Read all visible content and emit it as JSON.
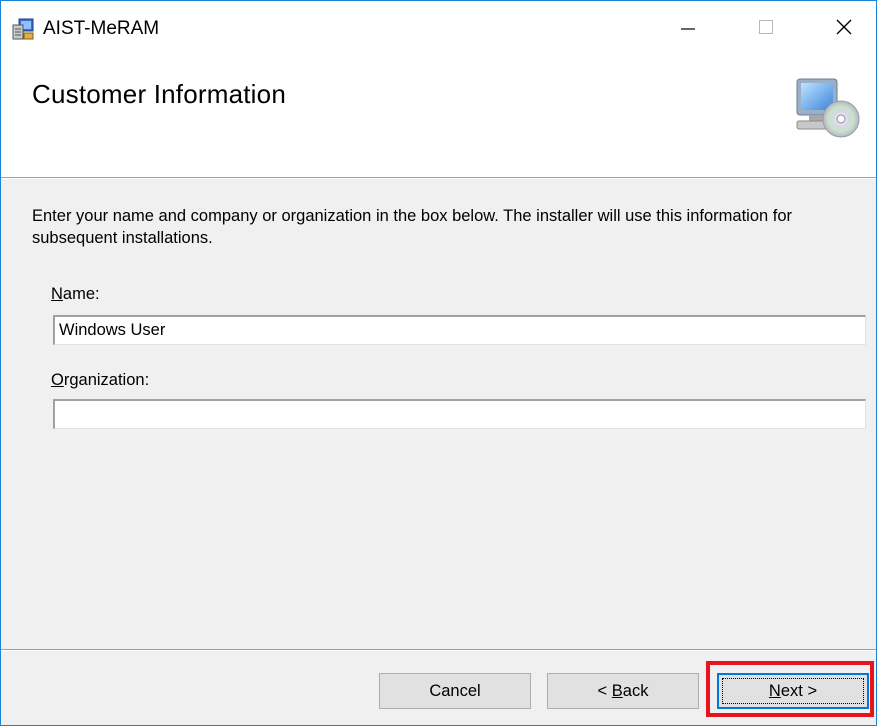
{
  "window": {
    "title": "AIST-MeRAM",
    "app_icon": "installer-icon",
    "controls": {
      "minimize_icon": "minimize-icon",
      "maximize_icon": "maximize-icon",
      "close_icon": "close-icon"
    }
  },
  "header": {
    "title": "Customer Information",
    "graphic_icon": "computer-cd-icon"
  },
  "body": {
    "description": "Enter your name and company or organization in the box below. The installer will use this information for subsequent installations.",
    "name_label_access": "N",
    "name_label_rest": "ame:",
    "name_value": "Windows User",
    "org_label_access": "O",
    "org_label_rest": "rganization:",
    "org_value": ""
  },
  "footer": {
    "cancel_label": "Cancel",
    "back_prefix": "< ",
    "back_access": "B",
    "back_rest": "ack",
    "next_access": "N",
    "next_rest": "ext >"
  },
  "colors": {
    "window_border": "#1883d7",
    "focus_border": "#0078d7",
    "highlight": "#e8141d"
  }
}
